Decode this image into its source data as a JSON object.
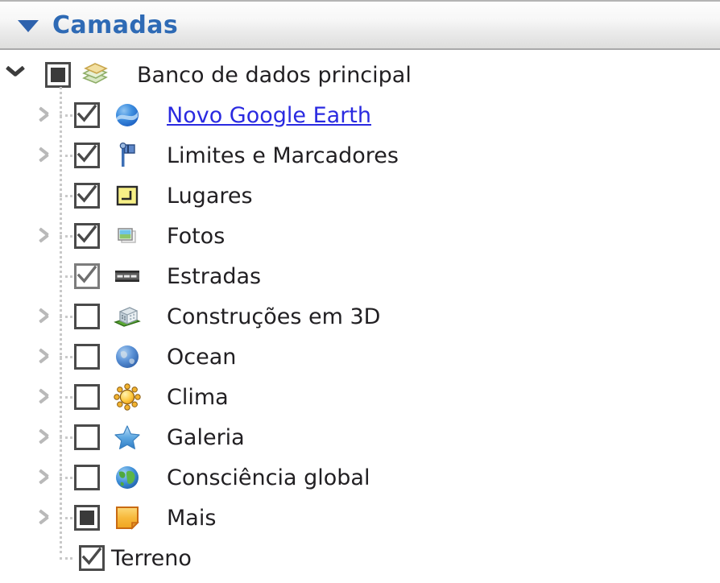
{
  "panel": {
    "title": "Camadas",
    "collapse_icon": "triangle-down-icon",
    "accent_color": "#2e6ab5"
  },
  "tree": {
    "root": {
      "label": "Banco de dados principal",
      "icon": "layers-stack-icon",
      "checkbox_state": "indeterminate",
      "expander": "chevron-down-icon",
      "expanded": true
    },
    "items": [
      {
        "label": "Novo Google Earth",
        "icon": "earth-blue-sphere-icon",
        "checkbox_state": "checked",
        "expandable": true,
        "is_link": true
      },
      {
        "label": "Limites e Marcadores",
        "icon": "flag-marker-icon",
        "checkbox_state": "checked",
        "expandable": true,
        "is_link": false
      },
      {
        "label": "Lugares",
        "icon": "yellow-placemark-icon",
        "checkbox_state": "checked",
        "expandable": false,
        "is_link": false
      },
      {
        "label": "Fotos",
        "icon": "photo-thumbnail-icon",
        "checkbox_state": "checked",
        "expandable": true,
        "is_link": false
      },
      {
        "label": "Estradas",
        "icon": "road-icon",
        "checkbox_state": "checked",
        "expandable": false,
        "is_link": false
      },
      {
        "label": "Construções em 3D",
        "icon": "building-3d-icon",
        "checkbox_state": "unchecked",
        "expandable": true,
        "is_link": false
      },
      {
        "label": "Ocean",
        "icon": "ocean-globe-icon",
        "checkbox_state": "unchecked",
        "expandable": true,
        "is_link": false
      },
      {
        "label": "Clima",
        "icon": "sun-weather-icon",
        "checkbox_state": "unchecked",
        "expandable": true,
        "is_link": false
      },
      {
        "label": "Galeria",
        "icon": "blue-star-icon",
        "checkbox_state": "unchecked",
        "expandable": true,
        "is_link": false
      },
      {
        "label": "Consciência global",
        "icon": "globe-green-icon",
        "checkbox_state": "unchecked",
        "expandable": true,
        "is_link": false
      },
      {
        "label": "Mais",
        "icon": "orange-note-icon",
        "checkbox_state": "indeterminate",
        "expandable": true,
        "is_link": false
      },
      {
        "label": "Terreno",
        "icon": null,
        "checkbox_state": "checked",
        "expandable": false,
        "is_link": false
      }
    ]
  }
}
